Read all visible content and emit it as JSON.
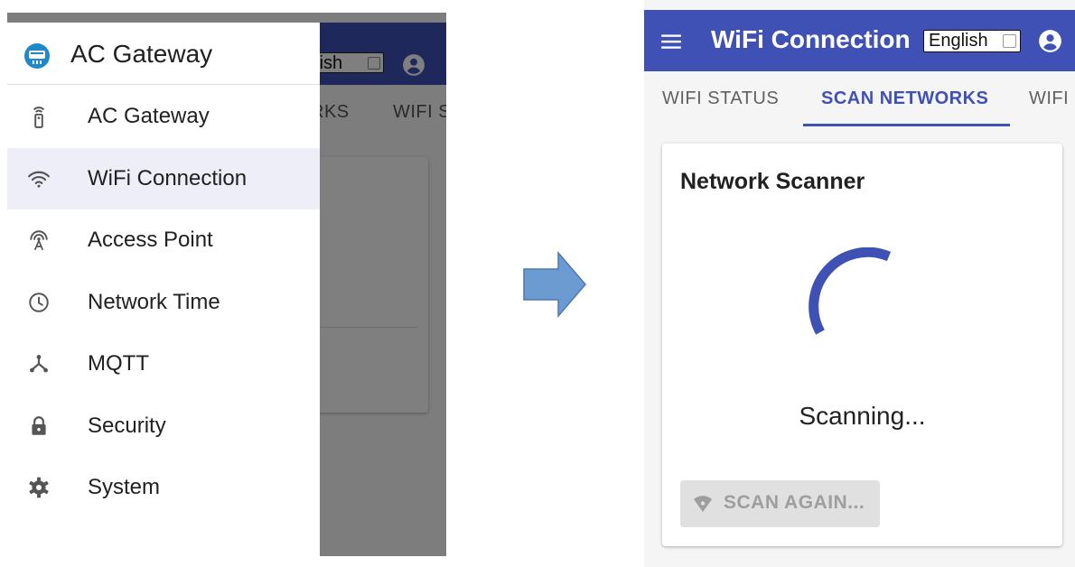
{
  "left_screen": {
    "background": {
      "language_select": {
        "value": "glish"
      },
      "tabs": [
        {
          "label": "RKS"
        },
        {
          "label": "WIFI S"
        }
      ]
    },
    "drawer": {
      "title": "AC Gateway",
      "items": [
        {
          "label": "AC Gateway",
          "icon": "remote-control-icon",
          "active": false
        },
        {
          "label": "WiFi Connection",
          "icon": "wifi-icon",
          "active": true
        },
        {
          "label": "Access Point",
          "icon": "access-point-icon",
          "active": false
        },
        {
          "label": "Network Time",
          "icon": "clock-icon",
          "active": false
        },
        {
          "label": "MQTT",
          "icon": "mqtt-hub-icon",
          "active": false
        },
        {
          "label": "Security",
          "icon": "lock-icon",
          "active": false
        },
        {
          "label": "System",
          "icon": "gear-icon",
          "active": false
        }
      ]
    }
  },
  "right_screen": {
    "appbar": {
      "title": "WiFi Connection",
      "language_select": {
        "value": "English"
      }
    },
    "tabs": [
      {
        "label": "WIFI STATUS",
        "active": false
      },
      {
        "label": "SCAN NETWORKS",
        "active": true
      },
      {
        "label": "WIFI",
        "active": false
      }
    ],
    "card": {
      "title": "Network Scanner",
      "status": "Scanning...",
      "button": {
        "label": "SCAN AGAIN...",
        "disabled": true,
        "icon": "wifi-signal-icon"
      }
    }
  },
  "colors": {
    "primary": "#3f51b5",
    "drawer_active_bg": "#eeeef8",
    "arrow_fill": "#6b9bd0",
    "arrow_stroke": "#4a7ab0",
    "button_disabled_bg": "#e0e0e0",
    "button_disabled_text": "#9e9e9e"
  }
}
